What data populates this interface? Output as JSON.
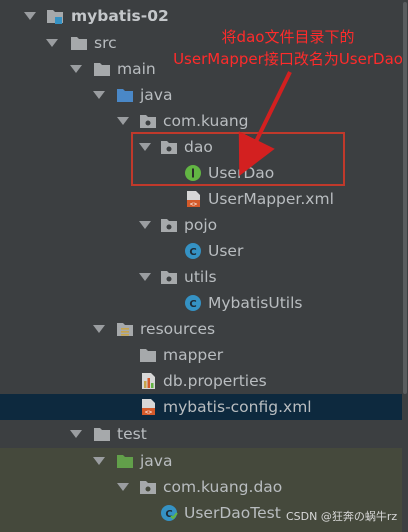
{
  "tree": {
    "project": "mybatis-02",
    "src": "src",
    "main": "main",
    "java": "java",
    "package": "com.kuang",
    "dao": "dao",
    "user_dao": "UserDao",
    "user_mapper_xml": "UserMapper.xml",
    "pojo": "pojo",
    "user": "User",
    "utils": "utils",
    "mybatis_utils": "MybatisUtils",
    "resources": "resources",
    "mapper": "mapper",
    "db_properties": "db.properties",
    "mybatis_config": "mybatis-config.xml",
    "test": "test",
    "test_java": "java",
    "test_package": "com.kuang.dao",
    "user_dao_test": "UserDaoTest"
  },
  "annotation": {
    "line1": "将dao文件目录下的",
    "line2": "UserMapper接口改名为UserDao"
  },
  "watermark": "CSDN @狂奔の蜗牛rz",
  "colors": {
    "background": "#3c3f41",
    "selected_row": "#0d293e",
    "test_row": "#45493c",
    "annotation": "#ff2b2b"
  }
}
